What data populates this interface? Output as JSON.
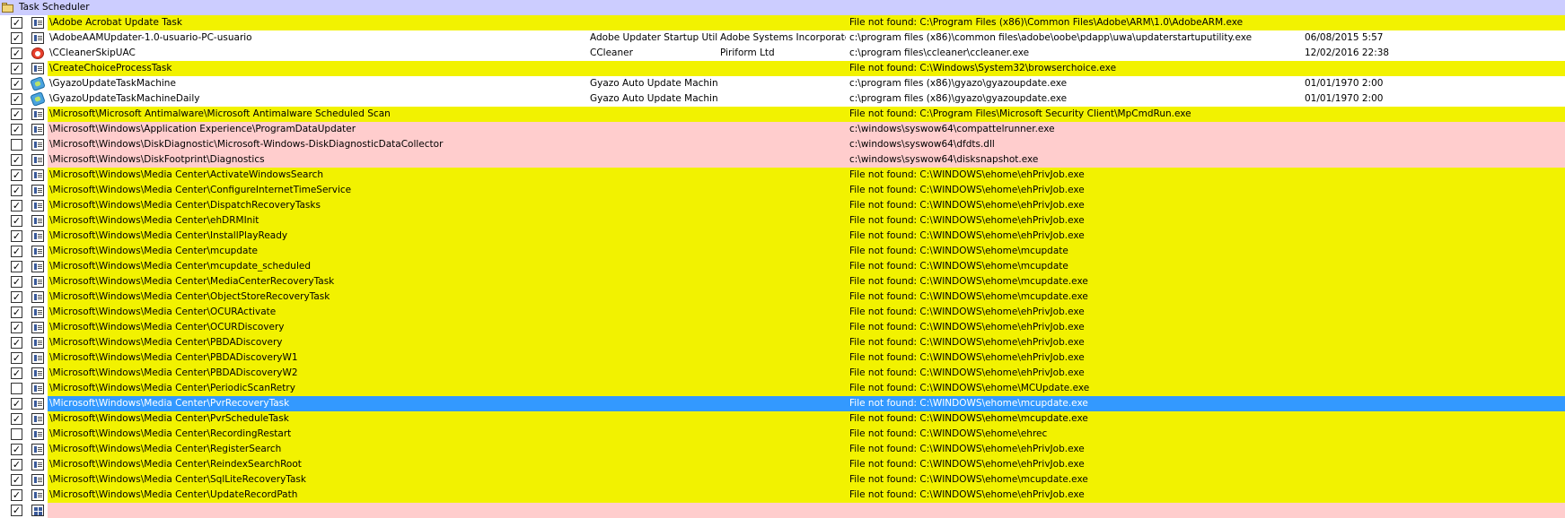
{
  "group": {
    "title": "Task Scheduler"
  },
  "rows": [
    {
      "checked": true,
      "icon": "window-icon",
      "style": "yellow",
      "name": "\\Adobe Acrobat Update Task",
      "description": "",
      "company": "",
      "path": "File not found: C:\\Program Files (x86)\\Common Files\\Adobe\\ARM\\1.0\\AdobeARM.exe",
      "date": ""
    },
    {
      "checked": true,
      "icon": "window-icon",
      "style": "white",
      "name": "\\AdobeAAMUpdater-1.0-usuario-PC-usuario",
      "description": "Adobe Updater Startup Utility",
      "company": "Adobe Systems Incorporated",
      "path": "c:\\program files (x86)\\common files\\adobe\\oobe\\pdapp\\uwa\\updaterstartuputility.exe",
      "date": "06/08/2015 5:57"
    },
    {
      "checked": true,
      "icon": "ccleaner-icon",
      "style": "white",
      "name": "\\CCleanerSkipUAC",
      "description": "CCleaner",
      "company": "Piriform Ltd",
      "path": "c:\\program files\\ccleaner\\ccleaner.exe",
      "date": "12/02/2016 22:38"
    },
    {
      "checked": true,
      "icon": "window-icon",
      "style": "yellow",
      "name": "\\CreateChoiceProcessTask",
      "description": "",
      "company": "",
      "path": "File not found: C:\\Windows\\System32\\browserchoice.exe",
      "date": ""
    },
    {
      "checked": true,
      "icon": "gyazo-icon",
      "style": "white",
      "name": "\\GyazoUpdateTaskMachine",
      "description": "Gyazo Auto Update Machine",
      "company": "",
      "path": "c:\\program files (x86)\\gyazo\\gyazoupdate.exe",
      "date": "01/01/1970 2:00"
    },
    {
      "checked": true,
      "icon": "gyazo-icon",
      "style": "white",
      "name": "\\GyazoUpdateTaskMachineDaily",
      "description": "Gyazo Auto Update Machine",
      "company": "",
      "path": "c:\\program files (x86)\\gyazo\\gyazoupdate.exe",
      "date": "01/01/1970 2:00"
    },
    {
      "checked": true,
      "icon": "window-icon",
      "style": "yellow",
      "name": "\\Microsoft\\Microsoft Antimalware\\Microsoft Antimalware Scheduled Scan",
      "description": "",
      "company": "",
      "path": "File not found: C:\\Program Files\\Microsoft Security Client\\MpCmdRun.exe",
      "date": ""
    },
    {
      "checked": true,
      "icon": "window-icon",
      "style": "pink",
      "name": "\\Microsoft\\Windows\\Application Experience\\ProgramDataUpdater",
      "description": "",
      "company": "",
      "path": "c:\\windows\\syswow64\\compattelrunner.exe",
      "date": ""
    },
    {
      "checked": false,
      "icon": "window-icon",
      "style": "pink",
      "name": "\\Microsoft\\Windows\\DiskDiagnostic\\Microsoft-Windows-DiskDiagnosticDataCollector",
      "description": "",
      "company": "",
      "path": "c:\\windows\\syswow64\\dfdts.dll",
      "date": ""
    },
    {
      "checked": true,
      "icon": "window-icon",
      "style": "pink",
      "name": "\\Microsoft\\Windows\\DiskFootprint\\Diagnostics",
      "description": "",
      "company": "",
      "path": "c:\\windows\\syswow64\\disksnapshot.exe",
      "date": ""
    },
    {
      "checked": true,
      "icon": "window-icon",
      "style": "yellow",
      "name": "\\Microsoft\\Windows\\Media Center\\ActivateWindowsSearch",
      "description": "",
      "company": "",
      "path": "File not found: C:\\WINDOWS\\ehome\\ehPrivJob.exe",
      "date": ""
    },
    {
      "checked": true,
      "icon": "window-icon",
      "style": "yellow",
      "name": "\\Microsoft\\Windows\\Media Center\\ConfigureInternetTimeService",
      "description": "",
      "company": "",
      "path": "File not found: C:\\WINDOWS\\ehome\\ehPrivJob.exe",
      "date": ""
    },
    {
      "checked": true,
      "icon": "window-icon",
      "style": "yellow",
      "name": "\\Microsoft\\Windows\\Media Center\\DispatchRecoveryTasks",
      "description": "",
      "company": "",
      "path": "File not found: C:\\WINDOWS\\ehome\\ehPrivJob.exe",
      "date": ""
    },
    {
      "checked": true,
      "icon": "window-icon",
      "style": "yellow",
      "name": "\\Microsoft\\Windows\\Media Center\\ehDRMInit",
      "description": "",
      "company": "",
      "path": "File not found: C:\\WINDOWS\\ehome\\ehPrivJob.exe",
      "date": ""
    },
    {
      "checked": true,
      "icon": "window-icon",
      "style": "yellow",
      "name": "\\Microsoft\\Windows\\Media Center\\InstallPlayReady",
      "description": "",
      "company": "",
      "path": "File not found: C:\\WINDOWS\\ehome\\ehPrivJob.exe",
      "date": ""
    },
    {
      "checked": true,
      "icon": "window-icon",
      "style": "yellow",
      "name": "\\Microsoft\\Windows\\Media Center\\mcupdate",
      "description": "",
      "company": "",
      "path": "File not found: C:\\WINDOWS\\ehome\\mcupdate",
      "date": ""
    },
    {
      "checked": true,
      "icon": "window-icon",
      "style": "yellow",
      "name": "\\Microsoft\\Windows\\Media Center\\mcupdate_scheduled",
      "description": "",
      "company": "",
      "path": "File not found: C:\\WINDOWS\\ehome\\mcupdate",
      "date": ""
    },
    {
      "checked": true,
      "icon": "window-icon",
      "style": "yellow",
      "name": "\\Microsoft\\Windows\\Media Center\\MediaCenterRecoveryTask",
      "description": "",
      "company": "",
      "path": "File not found: C:\\WINDOWS\\ehome\\mcupdate.exe",
      "date": ""
    },
    {
      "checked": true,
      "icon": "window-icon",
      "style": "yellow",
      "name": "\\Microsoft\\Windows\\Media Center\\ObjectStoreRecoveryTask",
      "description": "",
      "company": "",
      "path": "File not found: C:\\WINDOWS\\ehome\\mcupdate.exe",
      "date": ""
    },
    {
      "checked": true,
      "icon": "window-icon",
      "style": "yellow",
      "name": "\\Microsoft\\Windows\\Media Center\\OCURActivate",
      "description": "",
      "company": "",
      "path": "File not found: C:\\WINDOWS\\ehome\\ehPrivJob.exe",
      "date": ""
    },
    {
      "checked": true,
      "icon": "window-icon",
      "style": "yellow",
      "name": "\\Microsoft\\Windows\\Media Center\\OCURDiscovery",
      "description": "",
      "company": "",
      "path": "File not found: C:\\WINDOWS\\ehome\\ehPrivJob.exe",
      "date": ""
    },
    {
      "checked": true,
      "icon": "window-icon",
      "style": "yellow",
      "name": "\\Microsoft\\Windows\\Media Center\\PBDADiscovery",
      "description": "",
      "company": "",
      "path": "File not found: C:\\WINDOWS\\ehome\\ehPrivJob.exe",
      "date": ""
    },
    {
      "checked": true,
      "icon": "window-icon",
      "style": "yellow",
      "name": "\\Microsoft\\Windows\\Media Center\\PBDADiscoveryW1",
      "description": "",
      "company": "",
      "path": "File not found: C:\\WINDOWS\\ehome\\ehPrivJob.exe",
      "date": ""
    },
    {
      "checked": true,
      "icon": "window-icon",
      "style": "yellow",
      "name": "\\Microsoft\\Windows\\Media Center\\PBDADiscoveryW2",
      "description": "",
      "company": "",
      "path": "File not found: C:\\WINDOWS\\ehome\\ehPrivJob.exe",
      "date": ""
    },
    {
      "checked": false,
      "icon": "window-icon",
      "style": "yellow",
      "name": "\\Microsoft\\Windows\\Media Center\\PeriodicScanRetry",
      "description": "",
      "company": "",
      "path": "File not found: C:\\WINDOWS\\ehome\\MCUpdate.exe",
      "date": ""
    },
    {
      "checked": true,
      "icon": "window-icon",
      "style": "selected",
      "name": "\\Microsoft\\Windows\\Media Center\\PvrRecoveryTask",
      "description": "",
      "company": "",
      "path": "File not found: C:\\WINDOWS\\ehome\\mcupdate.exe",
      "date": ""
    },
    {
      "checked": true,
      "icon": "window-icon",
      "style": "yellow",
      "name": "\\Microsoft\\Windows\\Media Center\\PvrScheduleTask",
      "description": "",
      "company": "",
      "path": "File not found: C:\\WINDOWS\\ehome\\mcupdate.exe",
      "date": ""
    },
    {
      "checked": false,
      "icon": "window-icon",
      "style": "yellow",
      "name": "\\Microsoft\\Windows\\Media Center\\RecordingRestart",
      "description": "",
      "company": "",
      "path": "File not found: C:\\WINDOWS\\ehome\\ehrec",
      "date": ""
    },
    {
      "checked": true,
      "icon": "window-icon",
      "style": "yellow",
      "name": "\\Microsoft\\Windows\\Media Center\\RegisterSearch",
      "description": "",
      "company": "",
      "path": "File not found: C:\\WINDOWS\\ehome\\ehPrivJob.exe",
      "date": ""
    },
    {
      "checked": true,
      "icon": "window-icon",
      "style": "yellow",
      "name": "\\Microsoft\\Windows\\Media Center\\ReindexSearchRoot",
      "description": "",
      "company": "",
      "path": "File not found: C:\\WINDOWS\\ehome\\ehPrivJob.exe",
      "date": ""
    },
    {
      "checked": true,
      "icon": "window-icon",
      "style": "yellow",
      "name": "\\Microsoft\\Windows\\Media Center\\SqlLiteRecoveryTask",
      "description": "",
      "company": "",
      "path": "File not found: C:\\WINDOWS\\ehome\\mcupdate.exe",
      "date": ""
    },
    {
      "checked": true,
      "icon": "window-icon",
      "style": "yellow",
      "name": "\\Microsoft\\Windows\\Media Center\\UpdateRecordPath",
      "description": "",
      "company": "",
      "path": "File not found: C:\\WINDOWS\\ehome\\ehPrivJob.exe",
      "date": ""
    },
    {
      "checked": true,
      "icon": "windows-logo-icon",
      "style": "pink",
      "name": "",
      "description": "",
      "company": "",
      "path": "",
      "date": ""
    }
  ]
}
